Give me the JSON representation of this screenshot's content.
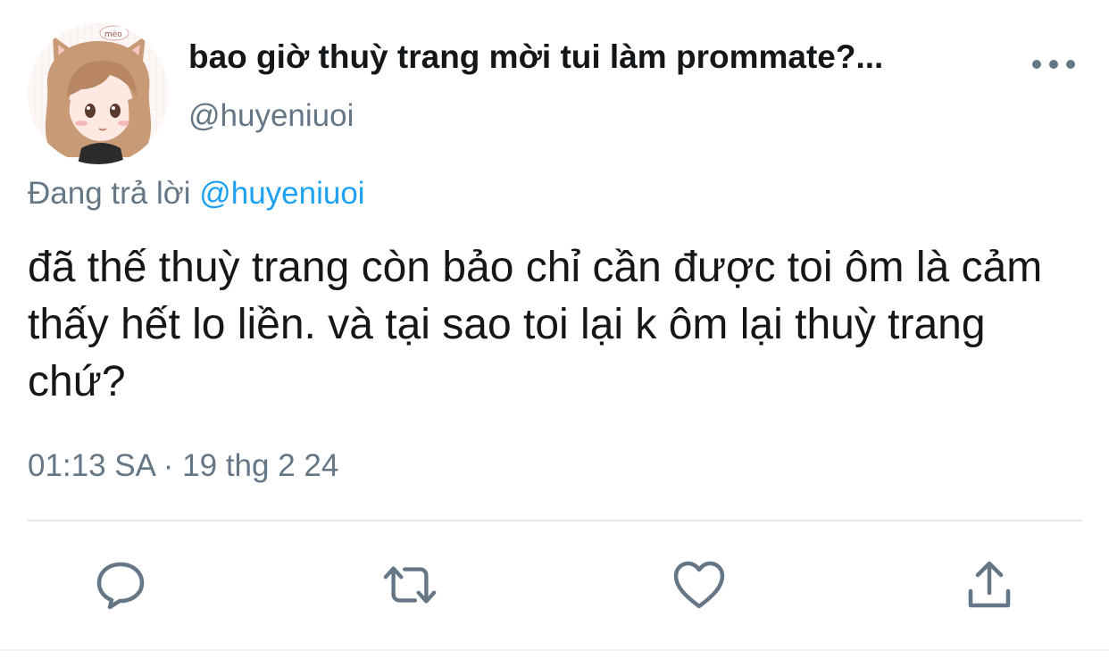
{
  "tweet": {
    "display_name": "bao giờ thuỳ trang mời tui làm prommate?...",
    "handle": "@huyeniuoi",
    "avatar_badge_text": "mèo",
    "reply_prefix": "Đang trả lời",
    "reply_handle": "@huyeniuoi",
    "text": "đã thế thuỳ trang còn bảo chỉ cần được toi ôm là cảm thấy hết lo liền. và tại sao toi lại k ôm lại thuỳ trang chứ?",
    "timestamp": "01:13 SA · 19 thg 2 24"
  },
  "actions": {
    "icons": [
      "reply-icon",
      "retweet-icon",
      "like-icon",
      "share-icon"
    ]
  },
  "colors": {
    "text": "#14171a",
    "secondary": "#657786",
    "accent": "#1da1f2",
    "divider": "#e1e8ed"
  }
}
